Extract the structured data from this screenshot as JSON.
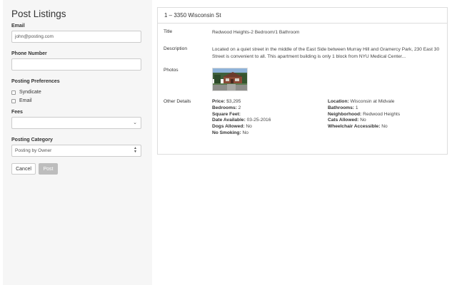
{
  "sidebar": {
    "title": "Post Listings",
    "email": {
      "label": "Email",
      "value": "john@posting.com"
    },
    "phone": {
      "label": "Phone Number",
      "value": ""
    },
    "preferences": {
      "label": "Posting Preferences",
      "options": [
        "Syndicate",
        "Email"
      ]
    },
    "fees": {
      "label": "Fees",
      "value": ""
    },
    "category": {
      "label": "Posting Category",
      "value": "Posting by Owner"
    },
    "buttons": {
      "cancel": "Cancel",
      "post": "Post"
    }
  },
  "listing": {
    "header": "1 – 3350 Wisconsin St",
    "title_label": "Title",
    "title_value": "Redwood Heights-2 Bedroom/1 Bathroom",
    "description_label": "Description",
    "description_value": "Located on a quiet street in the middle of the East Side between Murray Hill and Gramercy Park, 230 East 30 Street is convenient to all. This apartment building is only 1 block from NYU Medical Center...",
    "photos_label": "Photos",
    "other_label": "Other Details",
    "details": [
      {
        "key": "Price:",
        "value": "$3,295"
      },
      {
        "key": "Location:",
        "value": "Wisconsin at Midvale"
      },
      {
        "key": "Bedrooms:",
        "value": "2"
      },
      {
        "key": "Bathrooms:",
        "value": "1"
      },
      {
        "key": "Square Feet:",
        "value": ""
      },
      {
        "key": "Neighborhood:",
        "value": "Redwood Heights"
      },
      {
        "key": "Date Available:",
        "value": "03-25-2016"
      },
      {
        "key": "Cats Allowed:",
        "value": "No"
      },
      {
        "key": "Dogs Allowed:",
        "value": "No"
      },
      {
        "key": "Wheelchair Accessible:",
        "value": "No"
      },
      {
        "key": "No Smoking:",
        "value": "No"
      }
    ]
  },
  "colors": {
    "sidebar_bg": "#f6f6f6",
    "border": "#dddddd",
    "post_button": "#bdbdbd"
  }
}
